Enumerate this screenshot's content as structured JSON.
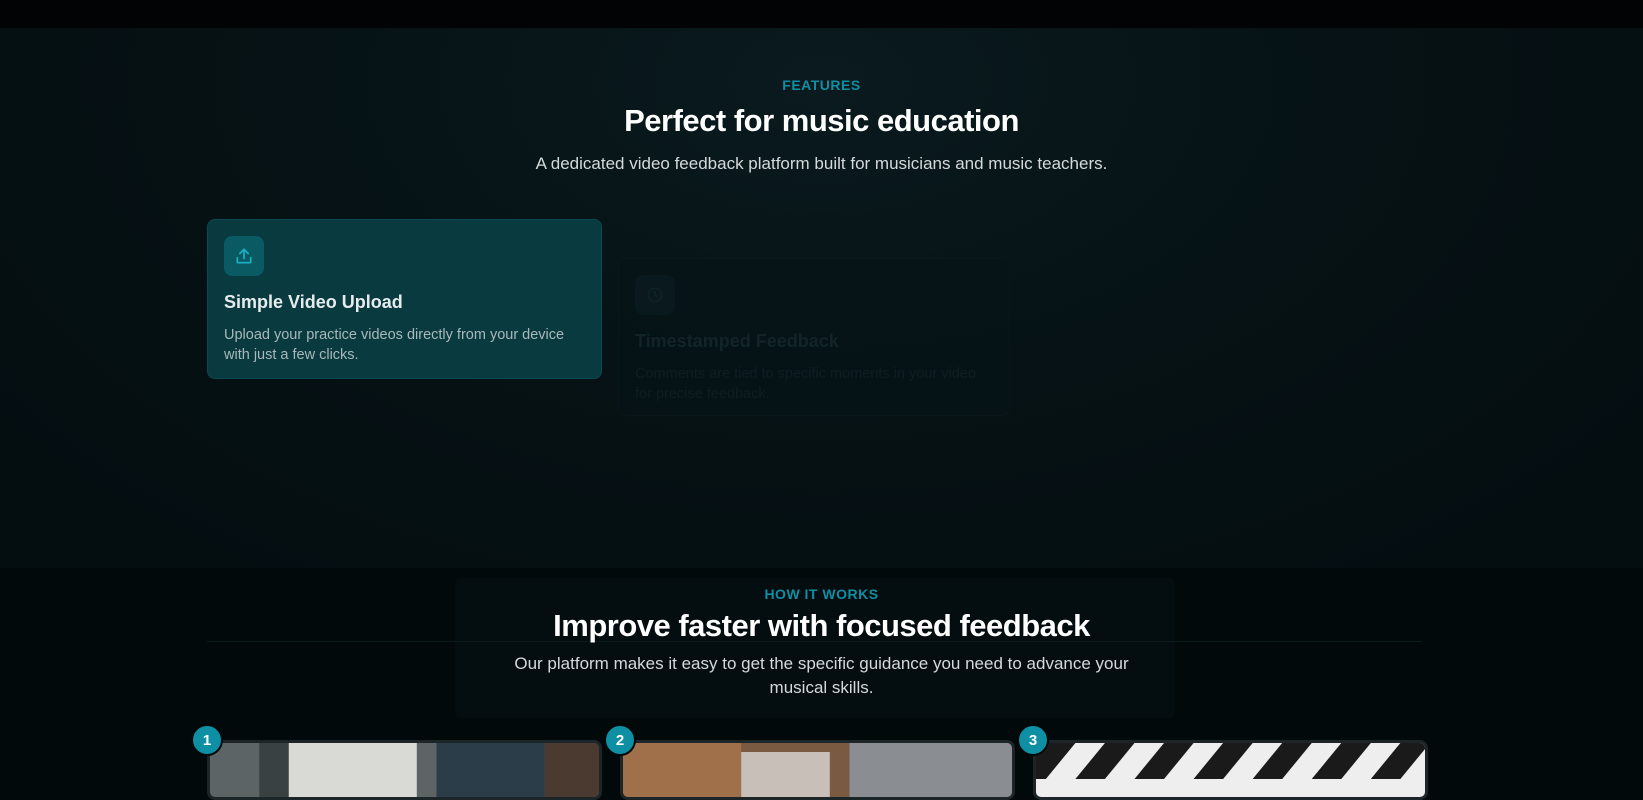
{
  "features": {
    "eyebrow": "FEATURES",
    "title": "Perfect for music education",
    "subtitle": "A dedicated video feedback platform built for musicians and music teachers.",
    "cards": [
      {
        "icon": "upload-icon",
        "title": "Simple Video Upload",
        "description": "Upload your practice videos directly from your device with just a few clicks."
      },
      {
        "icon": "clock-icon",
        "title": "Timestamped Feedback",
        "description": "Comments are tied to specific moments in your video for precise feedback."
      }
    ]
  },
  "how_it_works": {
    "eyebrow": "HOW IT WORKS",
    "title": "Improve faster with focused feedback",
    "subtitle": "Our platform makes it easy to get the specific guidance you need to advance your musical skills.",
    "steps": [
      {
        "number": "1"
      },
      {
        "number": "2"
      },
      {
        "number": "3"
      }
    ]
  },
  "colors": {
    "accent": "#0e8fa3",
    "background": "#02090b",
    "card_active": "#083a40"
  }
}
